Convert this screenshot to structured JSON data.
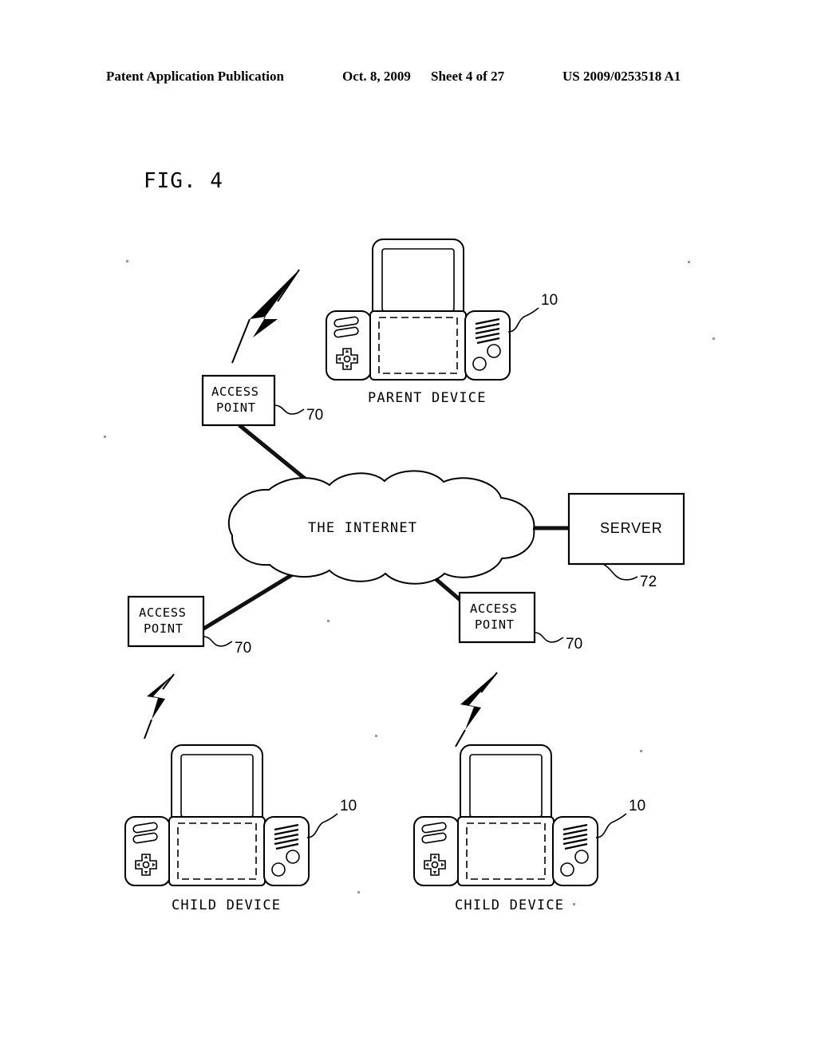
{
  "header": {
    "publication": "Patent Application Publication",
    "date": "Oct. 8, 2009",
    "sheet": "Sheet 4 of 27",
    "patent_number": "US 2009/0253518 A1"
  },
  "figure": {
    "label": "FIG. 4",
    "title": "Network configuration with parent device, access points, internet and server"
  },
  "nodes": {
    "parent_device": {
      "label": "PARENT DEVICE",
      "ref": "10",
      "icon": "handheld-game-console-icon"
    },
    "child_device_left": {
      "label": "CHILD DEVICE",
      "ref": "10",
      "icon": "handheld-game-console-icon"
    },
    "child_device_right": {
      "label": "CHILD DEVICE",
      "ref": "10",
      "icon": "handheld-game-console-icon"
    },
    "access_point_top": {
      "line1": "ACCESS",
      "line2": "POINT",
      "ref": "70"
    },
    "access_point_bottom_left": {
      "line1": "ACCESS",
      "line2": "POINT",
      "ref": "70"
    },
    "access_point_bottom_right": {
      "line1": "ACCESS",
      "line2": "POINT",
      "ref": "70"
    },
    "internet_cloud": {
      "label": "THE INTERNET",
      "icon": "cloud-icon"
    },
    "server": {
      "label": "SERVER",
      "ref": "72"
    }
  },
  "wireless_links": [
    {
      "name": "wireless-link-parent",
      "icon": "lightning-bolt-icon"
    },
    {
      "name": "wireless-link-child-left",
      "icon": "lightning-bolt-icon"
    },
    {
      "name": "wireless-link-child-right",
      "icon": "lightning-bolt-icon"
    }
  ],
  "colors": {
    "ink": "#000000",
    "paper": "#ffffff"
  }
}
